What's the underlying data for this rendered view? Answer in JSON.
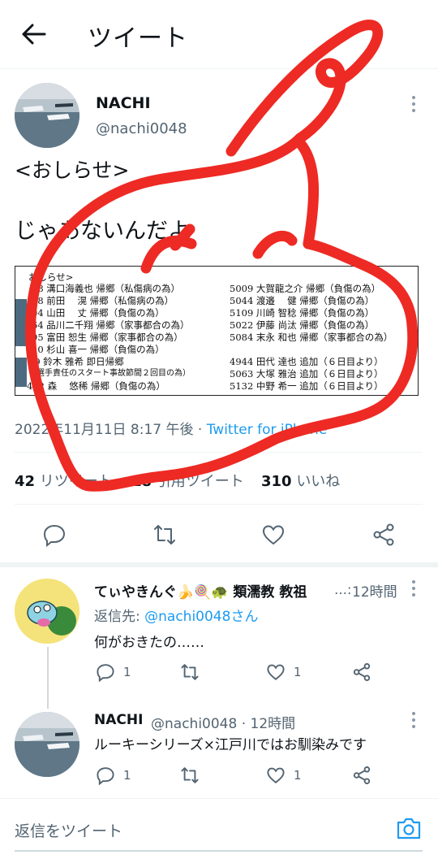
{
  "header": {
    "title": "ツイート"
  },
  "tweet": {
    "name": "NACHI",
    "handle": "@nachi0048",
    "text_line1": "<おしらせ>",
    "text_line2": "じゃあないんだよ",
    "notice_title": "おしらせ>",
    "notice_left": [
      "58 溝口海義也 帰郷（私傷病の為）",
      "68 前田　 滉 帰郷（私傷病の為）",
      "04 山田　 丈 帰郷（負傷の為）",
      "64 品川二千翔 帰郷（家事都合の為）",
      "95 富田 恕生 帰郷（家事都合の為）",
      "10 杉山 喜一 帰郷（負傷の為）",
      "49 鈴木 雅希 即日帰郷",
      "（選手責任のスタート事故節間２回目の為）",
      "492 森　 悠稀 帰郷（負傷の為）"
    ],
    "notice_right": [
      "5009 大賀龍之介 帰郷（負傷の為）",
      "5044 渡邉　 健 帰郷（負傷の為）",
      "5109 川崎 智稔 帰郷（負傷の為）",
      "5022 伊藤 尚汰 帰郷（負傷の為）",
      "5084 末永 和也 帰郷（家事都合の為）",
      "",
      "4944 田代 達也 追加（６日目より）",
      "5063 大塚 雅治 追加（６日目より）",
      "5132 中野 希一 追加（６日目より）"
    ],
    "meta_time": "2022年11月11日 8:17 午後 · ",
    "meta_source": "Twitter for iPhone",
    "retweets": "42",
    "retweets_label": "リツイート",
    "quotes": "18",
    "quotes_label": "引用ツイート",
    "likes": "310",
    "likes_label": "いいね"
  },
  "replies": [
    {
      "name": "てぃやきんぐ🍌🍭🐢 類濡教 教祖",
      "handle_short": "…:",
      "time": "12時間",
      "reply_to_label": "返信先: ",
      "reply_to_handle": "@nachi0048さん",
      "text": "何がおきたの……",
      "reply_count": "1",
      "like_count": "1"
    },
    {
      "name": "NACHI",
      "handle": "@nachi0048 · 12時間",
      "text": "ルーキーシリーズ×江戸川ではお馴染みです",
      "reply_count": "1",
      "like_count": "1"
    }
  ],
  "compose": {
    "placeholder": "返信をツイート"
  },
  "colors": {
    "accent": "#1d9bf0",
    "annotation": "#ee2a24",
    "muted": "#536471"
  },
  "icons": [
    "back-arrow-icon",
    "more-icon",
    "reply-icon",
    "retweet-icon",
    "like-icon",
    "share-icon",
    "camera-icon"
  ]
}
